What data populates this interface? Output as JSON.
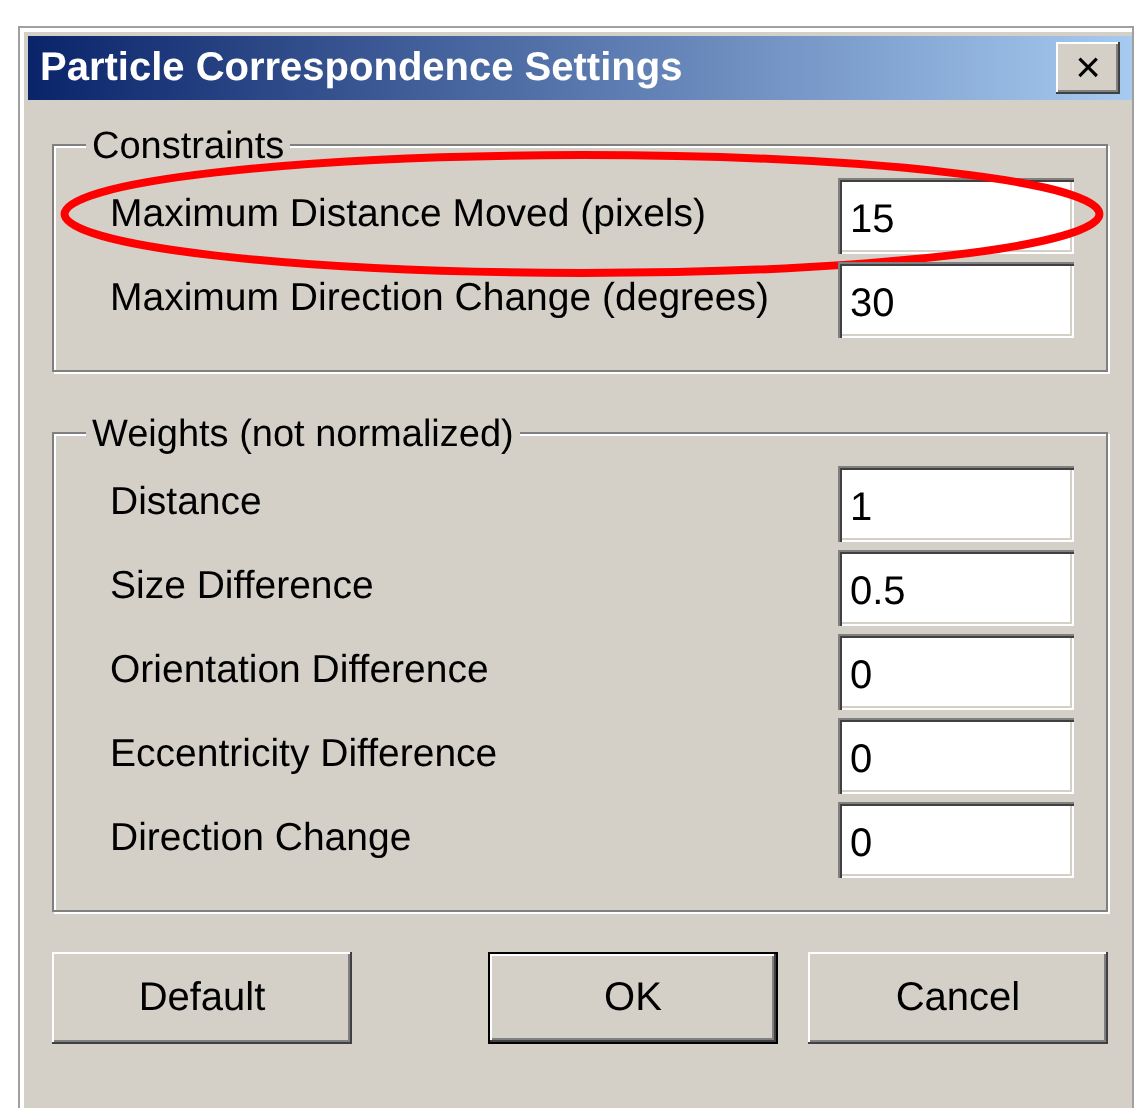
{
  "window": {
    "title": "Particle Correspondence Settings",
    "close": "×"
  },
  "constraints": {
    "title": "Constraints",
    "fields": [
      {
        "label": "Maximum Distance Moved (pixels)",
        "value": "15",
        "circled": true
      },
      {
        "label": "Maximum Direction Change (degrees)",
        "value": "30",
        "circled": false
      }
    ]
  },
  "weights": {
    "title": "Weights (not normalized)",
    "fields": [
      {
        "label": "Distance",
        "value": "1"
      },
      {
        "label": "Size Difference",
        "value": "0.5"
      },
      {
        "label": "Orientation Difference",
        "value": "0"
      },
      {
        "label": "Eccentricity Difference",
        "value": "0"
      },
      {
        "label": "Direction Change",
        "value": "0"
      }
    ]
  },
  "buttons": [
    {
      "label": "Default",
      "default": false
    },
    {
      "label": "OK",
      "default": true
    },
    {
      "label": "Cancel",
      "default": false
    }
  ]
}
